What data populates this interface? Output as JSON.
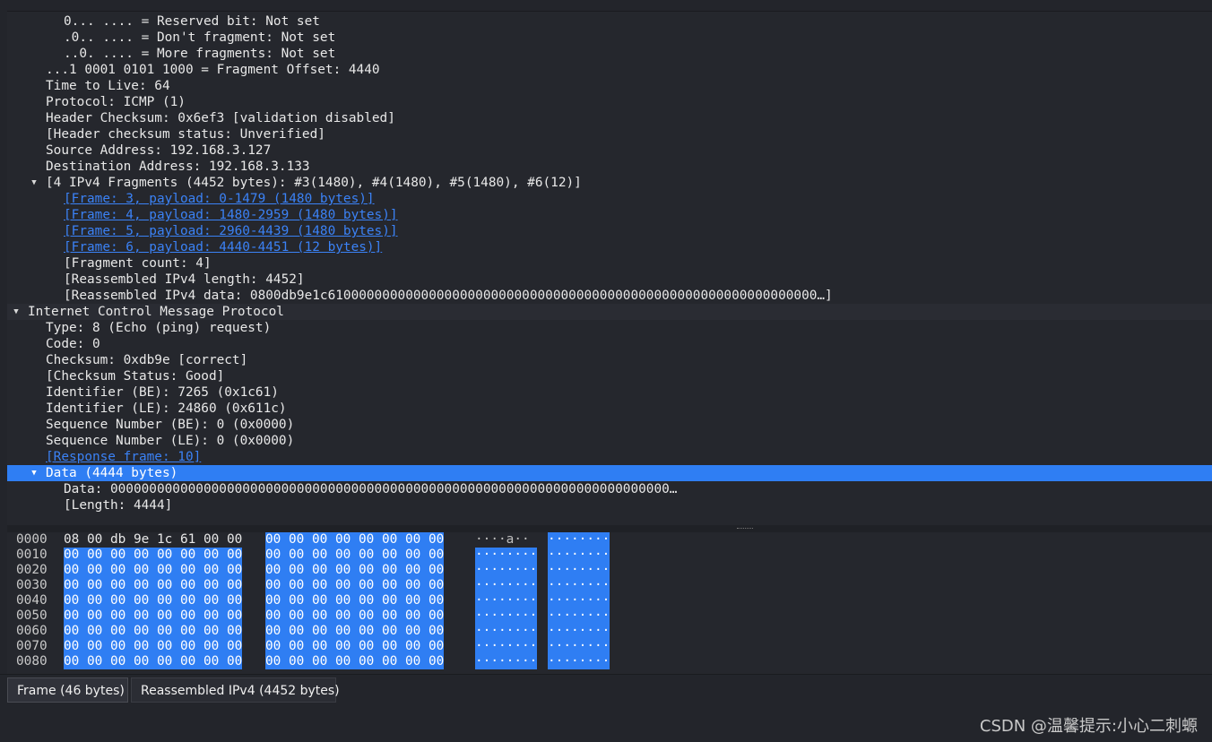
{
  "tree": {
    "lines": [
      "0... .... = Reserved bit: Not set",
      ".0.. .... = Don't fragment: Not set",
      "..0. .... = More fragments: Not set",
      "...1 0001 0101 1000 = Fragment Offset: 4440",
      "Time to Live: 64",
      "Protocol: ICMP (1)",
      "Header Checksum: 0x6ef3 [validation disabled]",
      "[Header checksum status: Unverified]",
      "Source Address: 192.168.3.127",
      "Destination Address: 192.168.3.133",
      "[4 IPv4 Fragments (4452 bytes): #3(1480), #4(1480), #5(1480), #6(12)]",
      "[Frame: 3, payload: 0-1479 (1480 bytes)]",
      "[Frame: 4, payload: 1480-2959 (1480 bytes)]",
      "[Frame: 5, payload: 2960-4439 (1480 bytes)]",
      "[Frame: 6, payload: 4440-4451 (12 bytes)]",
      "[Fragment count: 4]",
      "[Reassembled IPv4 length: 4452]",
      "[Reassembled IPv4 data: 0800db9e1c610000000000000000000000000000000000000000000000000000000000000…]",
      "Internet Control Message Protocol",
      "Type: 8 (Echo (ping) request)",
      "Code: 0",
      "Checksum: 0xdb9e [correct]",
      "[Checksum Status: Good]",
      "Identifier (BE): 7265 (0x1c61)",
      "Identifier (LE): 24860 (0x611c)",
      "Sequence Number (BE): 0 (0x0000)",
      "Sequence Number (LE): 0 (0x0000)",
      "[Response frame: 10]",
      "Data (4444 bytes)",
      "Data: 000000000000000000000000000000000000000000000000000000000000000000000000…",
      "[Length: 4444]"
    ]
  },
  "hex": {
    "rows": [
      {
        "offset": "0000",
        "a": "08 00 db 9e 1c 61 00 00",
        "b": "00 00 00 00 00 00 00 00",
        "asc_a": "····a··",
        "asc_a_tail": " ",
        "asc_b": "········"
      },
      {
        "offset": "0010",
        "a": "00 00 00 00 00 00 00 00",
        "b": "00 00 00 00 00 00 00 00",
        "asc_a": "········",
        "asc_b": "········"
      },
      {
        "offset": "0020",
        "a": "00 00 00 00 00 00 00 00",
        "b": "00 00 00 00 00 00 00 00",
        "asc_a": "········",
        "asc_b": "········"
      },
      {
        "offset": "0030",
        "a": "00 00 00 00 00 00 00 00",
        "b": "00 00 00 00 00 00 00 00",
        "asc_a": "········",
        "asc_b": "········"
      },
      {
        "offset": "0040",
        "a": "00 00 00 00 00 00 00 00",
        "b": "00 00 00 00 00 00 00 00",
        "asc_a": "········",
        "asc_b": "········"
      },
      {
        "offset": "0050",
        "a": "00 00 00 00 00 00 00 00",
        "b": "00 00 00 00 00 00 00 00",
        "asc_a": "········",
        "asc_b": "········"
      },
      {
        "offset": "0060",
        "a": "00 00 00 00 00 00 00 00",
        "b": "00 00 00 00 00 00 00 00",
        "asc_a": "········",
        "asc_b": "········"
      },
      {
        "offset": "0070",
        "a": "00 00 00 00 00 00 00 00",
        "b": "00 00 00 00 00 00 00 00",
        "asc_a": "········",
        "asc_b": "········"
      },
      {
        "offset": "0080",
        "a": "00 00 00 00 00 00 00 00",
        "b": "00 00 00 00 00 00 00 00",
        "asc_a": "········",
        "asc_b": "········"
      }
    ]
  },
  "tabs": [
    "Frame (46 bytes)",
    "Reassembled IPv4 (4452 bytes)"
  ],
  "watermark": "CSDN @温馨提示:小心二刺螈",
  "colors": {
    "selection": "#2f7ef3",
    "link": "#3b82f6",
    "background": "#25272d"
  }
}
